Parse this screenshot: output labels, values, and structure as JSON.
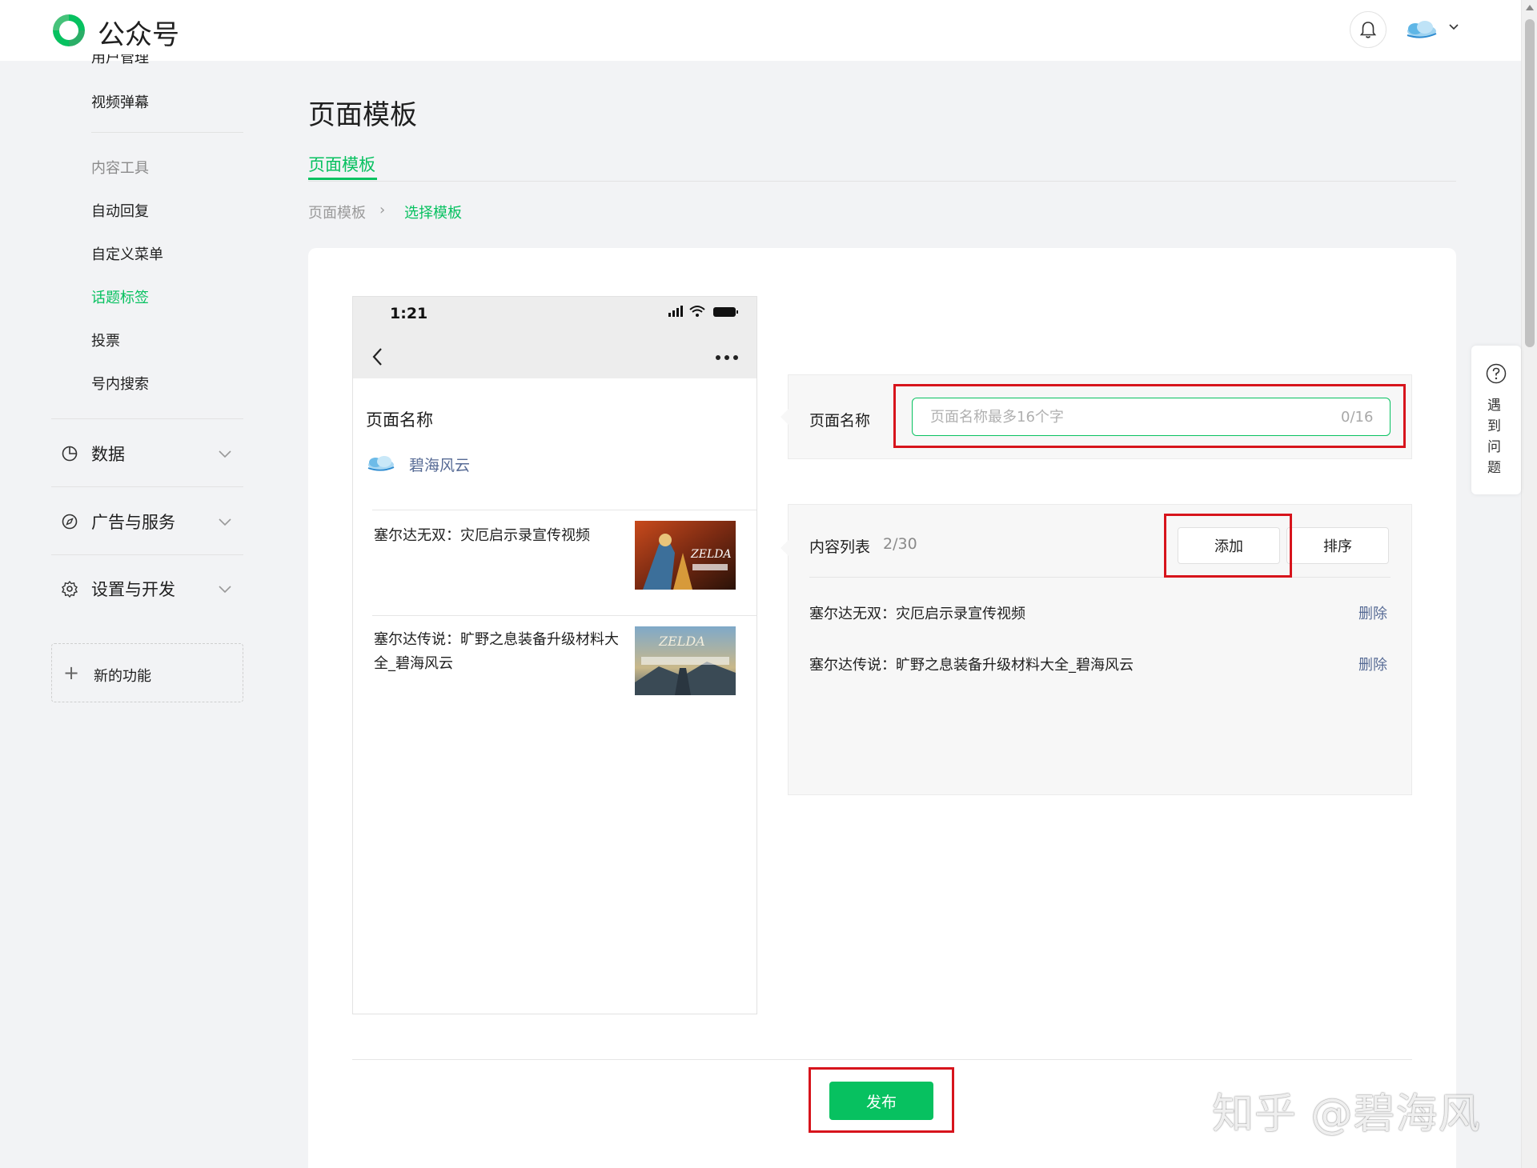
{
  "app": {
    "title": "公众号"
  },
  "sidebar": {
    "cut_item": "用户管理",
    "items_top": [
      "视频弹幕"
    ],
    "group_title": "内容工具",
    "items": [
      "自动回复",
      "自定义菜单",
      "话题标签",
      "投票",
      "号内搜索"
    ],
    "active_item": "话题标签",
    "sections": [
      "数据",
      "广告与服务",
      "设置与开发"
    ],
    "new_feature": "新的功能"
  },
  "main": {
    "page_title": "页面模板",
    "tab": "页面模板",
    "breadcrumb": [
      "页面模板",
      "选择模板"
    ]
  },
  "phone": {
    "time": "1:21",
    "page_name": "页面名称",
    "account_name": "碧海风云",
    "articles": [
      {
        "title": "塞尔达无双：灾厄启示录宣传视频"
      },
      {
        "title": "塞尔达传说：旷野之息装备升级材料大全_碧海风云"
      }
    ]
  },
  "form": {
    "name_label": "页面名称",
    "name_placeholder": "页面名称最多16个字",
    "name_value": "",
    "name_counter": "0/16",
    "list_label": "内容列表",
    "list_count": "2/30",
    "add_button": "添加",
    "sort_button": "排序",
    "list_items": [
      {
        "title": "塞尔达无双：灾厄启示录宣传视频",
        "action": "删除"
      },
      {
        "title": "塞尔达传说：旷野之息装备升级材料大全_碧海风云",
        "action": "删除"
      }
    ]
  },
  "publish_button": "发布",
  "help": {
    "text": "遇到问题"
  },
  "watermark": "知乎 @碧海风",
  "colors": {
    "accent": "#07c160",
    "link": "#576b95",
    "highlight": "#d7141c",
    "background": "#f2f3f5"
  }
}
